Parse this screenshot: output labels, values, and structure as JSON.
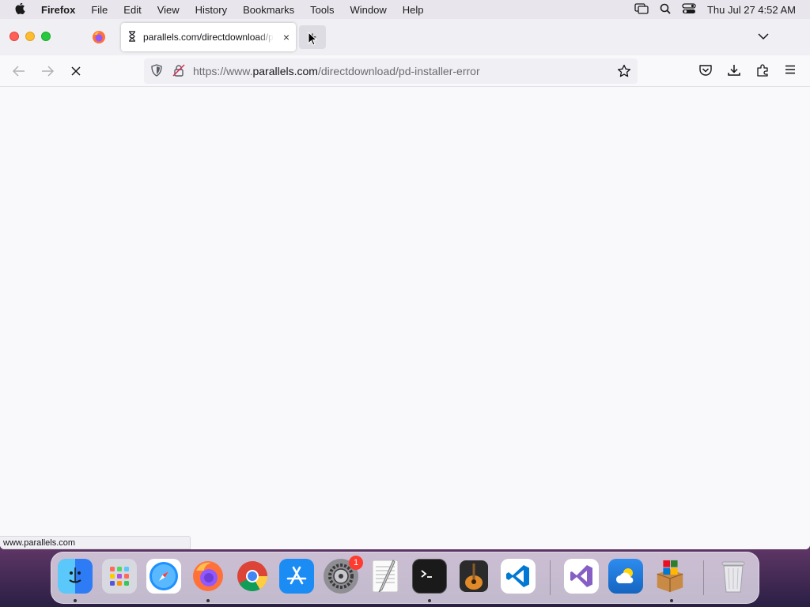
{
  "menubar": {
    "app_name": "Firefox",
    "items": [
      "File",
      "Edit",
      "View",
      "History",
      "Bookmarks",
      "Tools",
      "Window",
      "Help"
    ],
    "clock": "Thu Jul 27  4:52 AM"
  },
  "tab": {
    "title": "parallels.com/directdownload/pd-installer-error",
    "close_label": "×"
  },
  "newtab_label": "+",
  "urlbar": {
    "url_prefix": "https://www.",
    "url_host": "parallels.com",
    "url_path": "/directdownload/pd-installer-error"
  },
  "statusbar": {
    "text": "www.parallels.com"
  },
  "dock": {
    "items": [
      "finder-icon",
      "launchpad-icon",
      "safari-icon",
      "firefox-icon",
      "chrome-icon",
      "app-store-icon",
      "system-settings-icon",
      "textedit-icon",
      "terminal-icon",
      "garageband-icon",
      "vscode-icon",
      "visual-studio-icon",
      "weather-icon",
      "parallels-installer-icon",
      "trash-icon"
    ],
    "settings_badge": "1"
  },
  "colors": {
    "accent": "#0060df",
    "badge": "#ff3b30"
  }
}
